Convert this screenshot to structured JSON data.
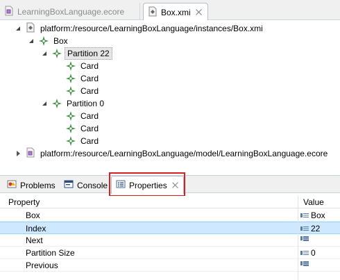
{
  "editor_tabs": [
    {
      "label": "LearningBoxLanguage.ecore",
      "active": false,
      "icon": "ecore-file-icon"
    },
    {
      "label": "Box.xmi",
      "active": true,
      "icon": "xmi-file-icon"
    }
  ],
  "tree": {
    "resource1": "platform:/resource/LearningBoxLanguage/instances/Box.xmi",
    "box": "Box",
    "partition22": "Partition 22",
    "card1": "Card",
    "card2": "Card",
    "card3": "Card",
    "partition0": "Partition 0",
    "card4": "Card",
    "card5": "Card",
    "card6": "Card",
    "resource2": "platform:/resource/LearningBoxLanguage/model/LearningBoxLanguage.ecore"
  },
  "view_tabs": {
    "problems": "Problems",
    "console": "Console",
    "properties": "Properties"
  },
  "properties": {
    "col_property": "Property",
    "col_value": "Value",
    "rows": [
      {
        "name": "Box",
        "value": "Box"
      },
      {
        "name": "Index",
        "value": "22"
      },
      {
        "name": "Next",
        "value": ""
      },
      {
        "name": "Partition Size",
        "value": "0"
      },
      {
        "name": "Previous",
        "value": ""
      }
    ]
  },
  "colors": {
    "highlight_box": "#d81e1e",
    "selected_row": "#cde8ff",
    "eobject_icon": "#3f8f3f"
  }
}
